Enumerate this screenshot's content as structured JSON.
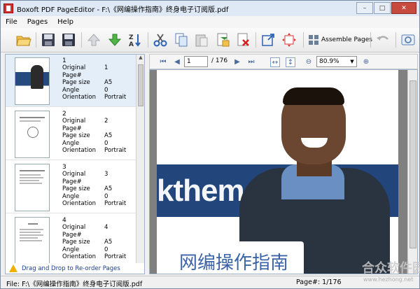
{
  "window": {
    "title": "Boxoft PDF PageEditor - F:\\《网编操作指南》终身电子订阅版.pdf",
    "minimize": "–",
    "maximize": "□",
    "close": "✕"
  },
  "menu": {
    "items": [
      "File",
      "Pages",
      "Help"
    ]
  },
  "toolbar": {
    "assemble_label": "Assemble Pages",
    "buttons": [
      "open-icon",
      "save-icon",
      "save-as-icon",
      "move-up-icon",
      "move-down-icon",
      "sort-icon",
      "cut-icon",
      "copy-icon",
      "paste-icon",
      "insert-icon",
      "delete-icon",
      "extract-icon",
      "rotate-icon",
      "assemble-icon",
      "undo-icon",
      "settings-icon"
    ]
  },
  "pages_panel": {
    "labels": {
      "original": "Original Page#",
      "size": "Page size",
      "angle": "Angle",
      "orientation": "Orientation"
    },
    "entries": [
      {
        "num": "1",
        "original": "1",
        "size": "A5",
        "angle": "0",
        "orientation": "Portrait"
      },
      {
        "num": "2",
        "original": "2",
        "size": "A5",
        "angle": "0",
        "orientation": "Portrait"
      },
      {
        "num": "3",
        "original": "3",
        "size": "A5",
        "angle": "0",
        "orientation": "Portrait"
      },
      {
        "num": "4",
        "original": "4",
        "size": "A5",
        "angle": "0",
        "orientation": "Portrait"
      }
    ],
    "hint": "Drag and Drop to Re-order Pages"
  },
  "viewer": {
    "current_page": "1",
    "total_pages": "/ 176",
    "zoom": "80.9%",
    "page_banner_text": "kthemes.co",
    "page_title_text": "网编操作指南"
  },
  "status": {
    "file": "File: F:\\《网编操作指南》终身电子订阅版.pdf",
    "page": "Page#: 1/176"
  },
  "watermark": {
    "text": "合众软件园",
    "url": "www.hezhong.net"
  }
}
